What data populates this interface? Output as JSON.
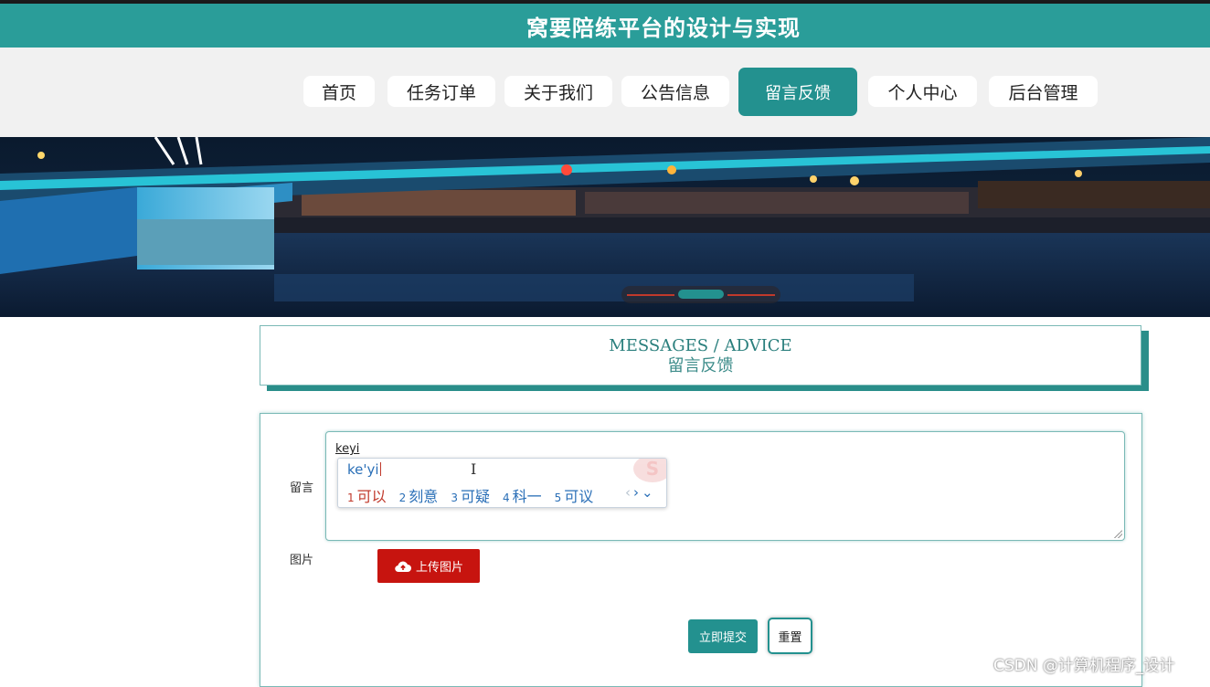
{
  "header": {
    "title": "窝要陪练平台的设计与实现"
  },
  "nav": {
    "items": [
      {
        "label": "首页"
      },
      {
        "label": "任务订单"
      },
      {
        "label": "关于我们"
      },
      {
        "label": "公告信息"
      },
      {
        "label": "留言反馈",
        "active": true
      },
      {
        "label": "个人中心"
      },
      {
        "label": "后台管理"
      }
    ]
  },
  "carousel": {
    "slides": 3,
    "active_index": 1
  },
  "section": {
    "title_en": "MESSAGES / ADVICE",
    "title_cn": "留言反馈"
  },
  "form": {
    "message_label": "留言",
    "message_value": "keyi",
    "image_label": "图片",
    "upload_label": "上传图片",
    "submit_label": "立即提交",
    "reset_label": "重置"
  },
  "ime": {
    "input": "ke'yi",
    "candidates": [
      {
        "num": "1",
        "text": "可以"
      },
      {
        "num": "2",
        "text": "刻意"
      },
      {
        "num": "3",
        "text": "可疑"
      },
      {
        "num": "4",
        "text": "科一"
      },
      {
        "num": "5",
        "text": "可议"
      }
    ],
    "logo": "S"
  },
  "colors": {
    "primary": "#23918f",
    "upload": "#c7140f"
  },
  "watermark": "CSDN @计算机程序_设计"
}
